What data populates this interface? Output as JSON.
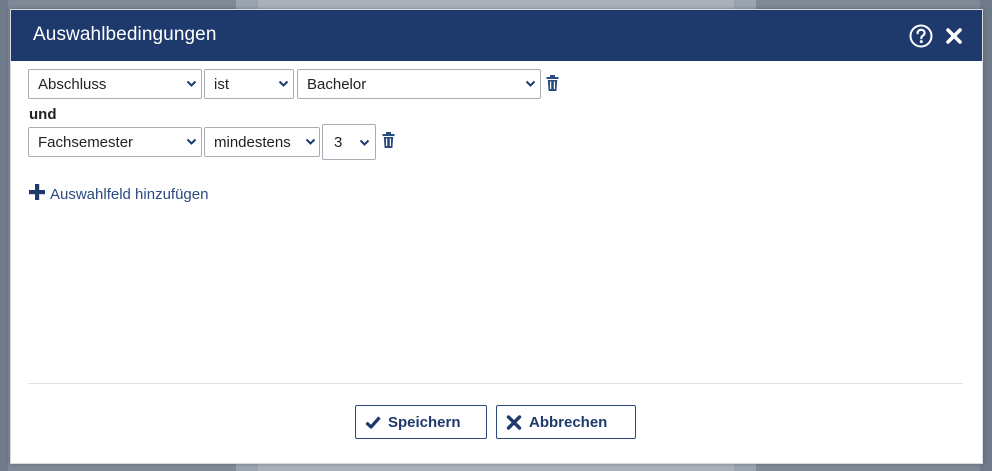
{
  "dialog": {
    "title": "Auswahlbedingungen",
    "help_icon": "help-circle-icon",
    "close_icon": "close-icon"
  },
  "conditions": [
    {
      "field": "Abschluss",
      "operator": "ist",
      "value": "Bachelor"
    },
    {
      "field": "Fachsemester",
      "operator": "mindestens",
      "value": "3"
    }
  ],
  "conjunction": "und",
  "add_field_label": "Auswahlfeld hinzufügen",
  "footer": {
    "save_label": "Speichern",
    "cancel_label": "Abbrechen"
  },
  "colors": {
    "header_bg": "#1e3a6d",
    "accent": "#2a4a80",
    "text": "#222222"
  }
}
